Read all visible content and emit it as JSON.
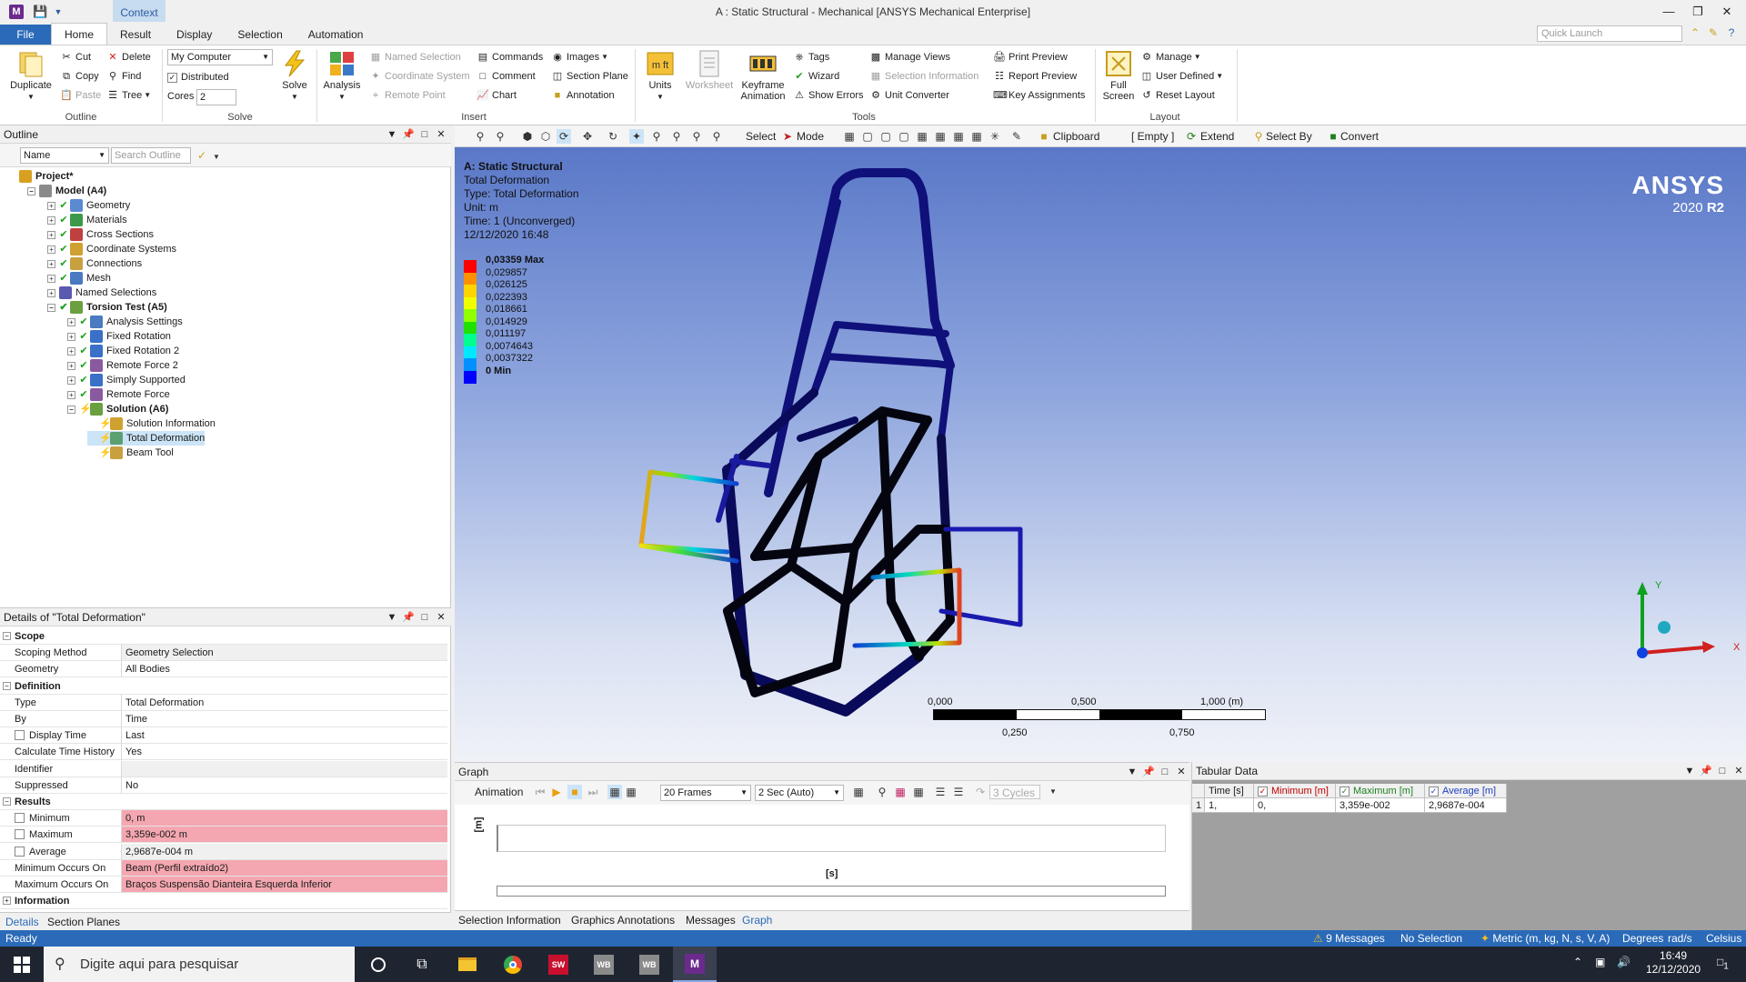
{
  "titlebar": {
    "app_letter": "M",
    "context_tab": "Context",
    "window_title": "A : Static Structural - Mechanical [ANSYS Mechanical Enterprise]",
    "minimize": "—",
    "restore": "❐",
    "close": "✕"
  },
  "ribbon_tabs": [
    "File",
    "Home",
    "Result",
    "Display",
    "Selection",
    "Automation"
  ],
  "quick_launch_placeholder": "Quick Launch",
  "ribbon": {
    "outline": {
      "label": "Outline",
      "duplicate": "Duplicate",
      "cut": "Cut",
      "copy": "Copy",
      "paste": "Paste",
      "delete": "Delete",
      "find": "Find",
      "tree": "Tree"
    },
    "solve": {
      "label": "Solve",
      "computer": "My Computer",
      "distributed": "Distributed",
      "cores_label": "Cores",
      "cores_value": "2",
      "solve_btn": "Solve"
    },
    "insert": {
      "label": "Insert",
      "analysis": "Analysis",
      "named_selection": "Named Selection",
      "coordinate_system": "Coordinate System",
      "remote_point": "Remote Point",
      "commands": "Commands",
      "comment": "Comment",
      "chart": "Chart",
      "images": "Images",
      "section_plane": "Section Plane",
      "annotation": "Annotation"
    },
    "tools": {
      "label": "Tools",
      "units": "Units",
      "worksheet": "Worksheet",
      "keyframe": "Keyframe",
      "animation": "Animation",
      "tags": "Tags",
      "wizard": "Wizard",
      "show_errors": "Show Errors",
      "manage_views": "Manage Views",
      "selection_information": "Selection Information",
      "unit_converter": "Unit Converter",
      "print_preview": "Print Preview",
      "report_preview": "Report Preview",
      "key_assignments": "Key Assignments"
    },
    "layout": {
      "label": "Layout",
      "full": "Full",
      "screen": "Screen",
      "manage": "Manage",
      "user_defined": "User Defined",
      "reset_layout": "Reset Layout"
    }
  },
  "outline_panel": {
    "title": "Outline",
    "name_filter": "Name",
    "search_placeholder": "Search Outline",
    "tree": [
      {
        "label": "Project*",
        "level": 0,
        "bold": true,
        "icon": "#d9a020"
      },
      {
        "label": "Model (A4)",
        "level": 1,
        "bold": true,
        "icon": "#8a8a8a"
      },
      {
        "label": "Geometry",
        "level": 2,
        "icon": "#5a8ad0",
        "status": "✔"
      },
      {
        "label": "Materials",
        "level": 2,
        "icon": "#3a9a4a",
        "status": "✔"
      },
      {
        "label": "Cross Sections",
        "level": 2,
        "icon": "#c04040",
        "status": "✔"
      },
      {
        "label": "Coordinate Systems",
        "level": 2,
        "icon": "#d0a030",
        "status": "✔"
      },
      {
        "label": "Connections",
        "level": 2,
        "icon": "#c8a040",
        "status": "✔"
      },
      {
        "label": "Mesh",
        "level": 2,
        "icon": "#4a7ac0",
        "status": "✔"
      },
      {
        "label": "Named Selections",
        "level": 2,
        "icon": "#5a5ab0",
        "status": ""
      },
      {
        "label": "Torsion Test (A5)",
        "level": 2,
        "bold": true,
        "icon": "#6aa040",
        "status": "✔"
      },
      {
        "label": "Analysis Settings",
        "level": 3,
        "icon": "#4a7ac0",
        "status": "✔"
      },
      {
        "label": "Fixed Rotation",
        "level": 3,
        "icon": "#3a70c8",
        "status": "✔"
      },
      {
        "label": "Fixed Rotation 2",
        "level": 3,
        "icon": "#3a70c8",
        "status": "✔"
      },
      {
        "label": "Remote Force 2",
        "level": 3,
        "icon": "#8a5aa0",
        "status": "✔"
      },
      {
        "label": "Simply Supported",
        "level": 3,
        "icon": "#3a70c8",
        "status": "✔"
      },
      {
        "label": "Remote Force",
        "level": 3,
        "icon": "#8a5aa0",
        "status": "✔"
      },
      {
        "label": "Solution (A6)",
        "level": 3,
        "bold": true,
        "icon": "#6aa040",
        "status": "⚡"
      },
      {
        "label": "Solution Information",
        "level": 4,
        "icon": "#d0a030",
        "status": "⚡"
      },
      {
        "label": "Total Deformation",
        "level": 4,
        "icon": "#5aa070",
        "status": "⚡",
        "selected": true
      },
      {
        "label": "Beam Tool",
        "level": 4,
        "icon": "#c8a040",
        "status": "⚡"
      }
    ]
  },
  "details_panel": {
    "title": "Details of \"Total Deformation\"",
    "rows": [
      {
        "type": "section",
        "key": "Scope"
      },
      {
        "key": "Scoping Method",
        "value": "Geometry Selection",
        "style": "gray"
      },
      {
        "key": "Geometry",
        "value": "All Bodies"
      },
      {
        "type": "section",
        "key": "Definition"
      },
      {
        "key": "Type",
        "value": "Total Deformation"
      },
      {
        "key": "By",
        "value": "Time"
      },
      {
        "key": "Display Time",
        "value": "Last",
        "check": true
      },
      {
        "key": "Calculate Time History",
        "value": "Yes"
      },
      {
        "key": "Identifier",
        "value": "",
        "style": "gray"
      },
      {
        "key": "Suppressed",
        "value": "No"
      },
      {
        "type": "section",
        "key": "Results"
      },
      {
        "key": "Minimum",
        "value": "0, m",
        "style": "pink",
        "check": true
      },
      {
        "key": "Maximum",
        "value": "3,359e-002 m",
        "style": "pink",
        "check": true
      },
      {
        "key": "Average",
        "value": "2,9687e-004 m",
        "style": "gray",
        "check": true
      },
      {
        "key": "Minimum Occurs On",
        "value": "Beam (Perfil extraído2)",
        "style": "pink"
      },
      {
        "key": "Maximum Occurs On",
        "value": "Braços Suspensão Dianteira Esquerda Inferior",
        "style": "pink"
      },
      {
        "type": "section",
        "key": "Information",
        "collapsed": true
      }
    ],
    "tabs": [
      "Details",
      "Section Planes"
    ]
  },
  "graphics_toolbar": {
    "select": "Select",
    "mode": "Mode",
    "clipboard": "Clipboard",
    "empty": "[ Empty ]",
    "extend": "Extend",
    "select_by": "Select By",
    "convert": "Convert"
  },
  "viewport": {
    "info": [
      "A: Static Structural",
      "Total Deformation",
      "Type: Total Deformation",
      "Unit: m",
      "Time: 1 (Unconverged)",
      "12/12/2020 16:48"
    ],
    "legend": {
      "labels": [
        "0,03359 Max",
        "0,029857",
        "0,026125",
        "0,022393",
        "0,018661",
        "0,014929",
        "0,011197",
        "0,0074643",
        "0,0037322",
        "0 Min"
      ],
      "colors": [
        "#ff0000",
        "#ff9000",
        "#ffd400",
        "#f0ff00",
        "#90ff00",
        "#20e000",
        "#00ff90",
        "#00e8ff",
        "#0090ff",
        "#0000ff"
      ]
    },
    "logo_name": "ANSYS",
    "logo_year": "2020",
    "logo_release": "R2",
    "scale": {
      "top": [
        "0,000",
        "0,500",
        "1,000 (m)"
      ],
      "bottom": [
        "0,250",
        "0,750"
      ]
    },
    "triad": {
      "x": "X",
      "y": "Y"
    }
  },
  "graph_panel": {
    "title": "Graph",
    "animation": "Animation",
    "frames": "20 Frames",
    "duration": "2 Sec (Auto)",
    "cycles": "3 Cycles",
    "yunit": "[m]",
    "xunit": "[s]",
    "tabs": [
      "Selection Information",
      "Graphics Annotations",
      "Messages",
      "Graph"
    ]
  },
  "tabular_panel": {
    "title": "Tabular Data",
    "columns": [
      "Time [s]",
      "Minimum [m]",
      "Maximum [m]",
      "Average [m]"
    ],
    "rows": [
      [
        "1",
        "1,",
        "0,",
        "3,359e-002",
        "2,9687e-004"
      ]
    ]
  },
  "statusbar": {
    "ready": "Ready",
    "messages": "9 Messages",
    "selection": "No Selection",
    "units": "Metric (m, kg, N, s, V, A)",
    "degrees": "Degrees",
    "rads": "rad/s",
    "celsius": "Celsius"
  },
  "taskbar": {
    "search": "Digite aqui para pesquisar",
    "time": "16:49",
    "date": "12/12/2020",
    "notifications": "1"
  }
}
